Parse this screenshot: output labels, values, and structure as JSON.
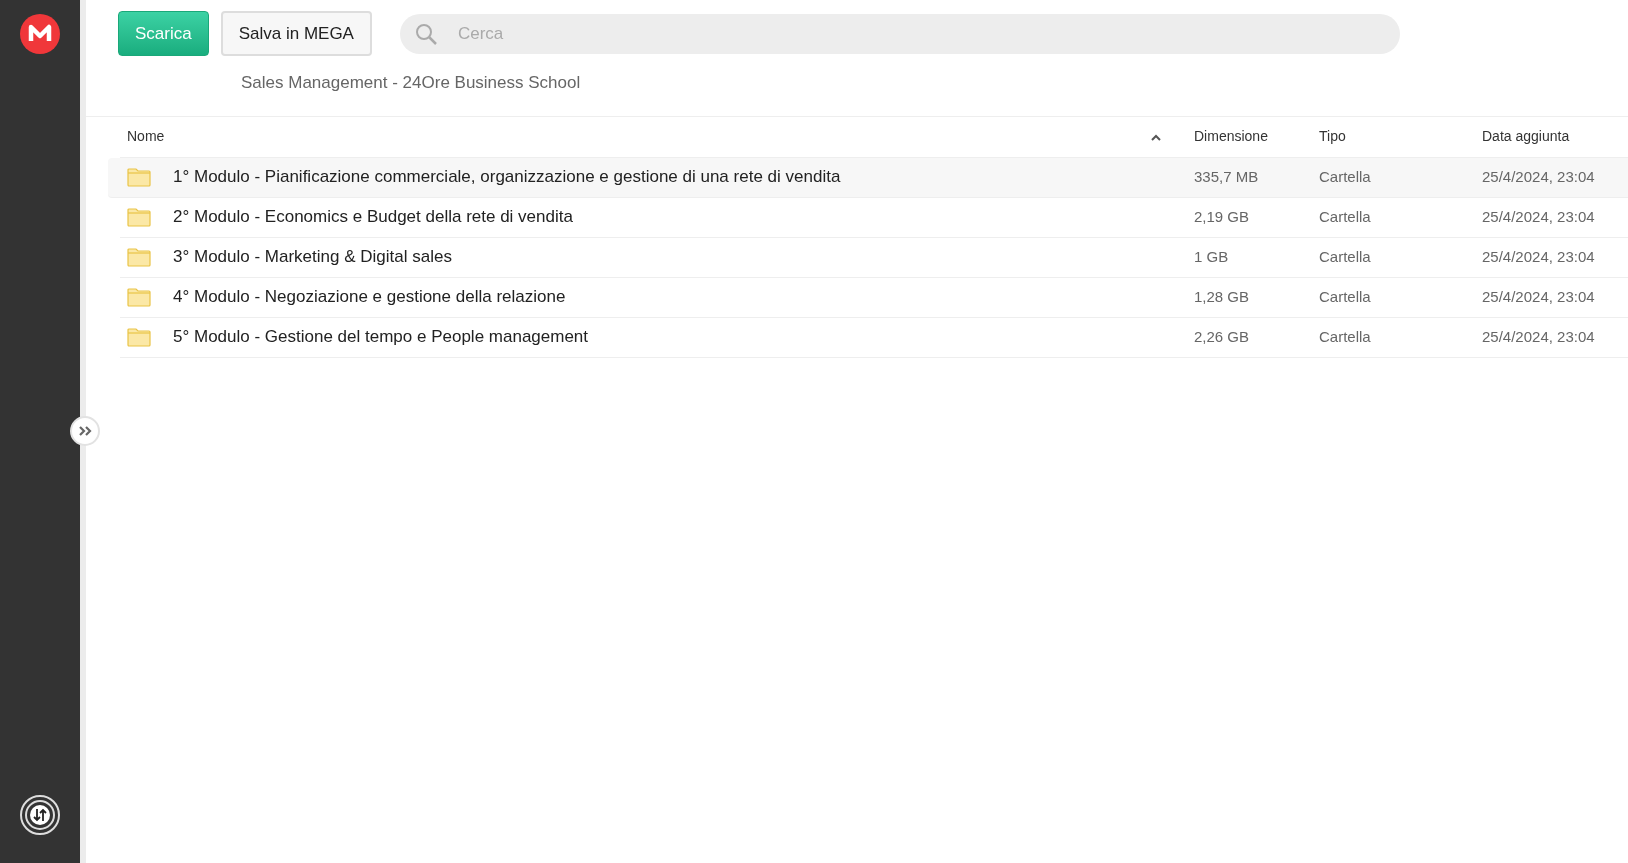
{
  "toolbar": {
    "buttons": [
      {
        "label": "Scarica",
        "kind": "primary"
      },
      {
        "label": "Salva in MEGA",
        "kind": "secondary"
      }
    ],
    "search": {
      "placeholder": "Cerca"
    }
  },
  "breadcrumb": "Sales Management - 24Ore Business School",
  "table": {
    "columns": [
      {
        "label": "Nome",
        "sorted": true
      },
      {
        "label": "Dimensione",
        "sorted": false
      },
      {
        "label": "Tipo",
        "sorted": false
      },
      {
        "label": "Data aggiunta",
        "sorted": false
      }
    ],
    "rows": [
      {
        "name": "1° Modulo - Pianificazione commerciale, organizzazione e gestione di una rete di vendita",
        "size": "335,7 MB",
        "type": "Cartella",
        "date": "25/4/2024, 23:04",
        "selected": true
      },
      {
        "name": "2° Modulo - Economics e Budget della rete di vendita",
        "size": "2,19 GB",
        "type": "Cartella",
        "date": "25/4/2024, 23:04",
        "selected": false
      },
      {
        "name": "3° Modulo - Marketing & Digital sales",
        "size": "1 GB",
        "type": "Cartella",
        "date": "25/4/2024, 23:04",
        "selected": false
      },
      {
        "name": "4° Modulo - Negoziazione e gestione della relazione",
        "size": "1,28 GB",
        "type": "Cartella",
        "date": "25/4/2024, 23:04",
        "selected": false
      },
      {
        "name": "5° Modulo - Gestione del tempo e People management",
        "size": "2,26 GB",
        "type": "Cartella",
        "date": "25/4/2024, 23:04",
        "selected": false
      }
    ]
  }
}
